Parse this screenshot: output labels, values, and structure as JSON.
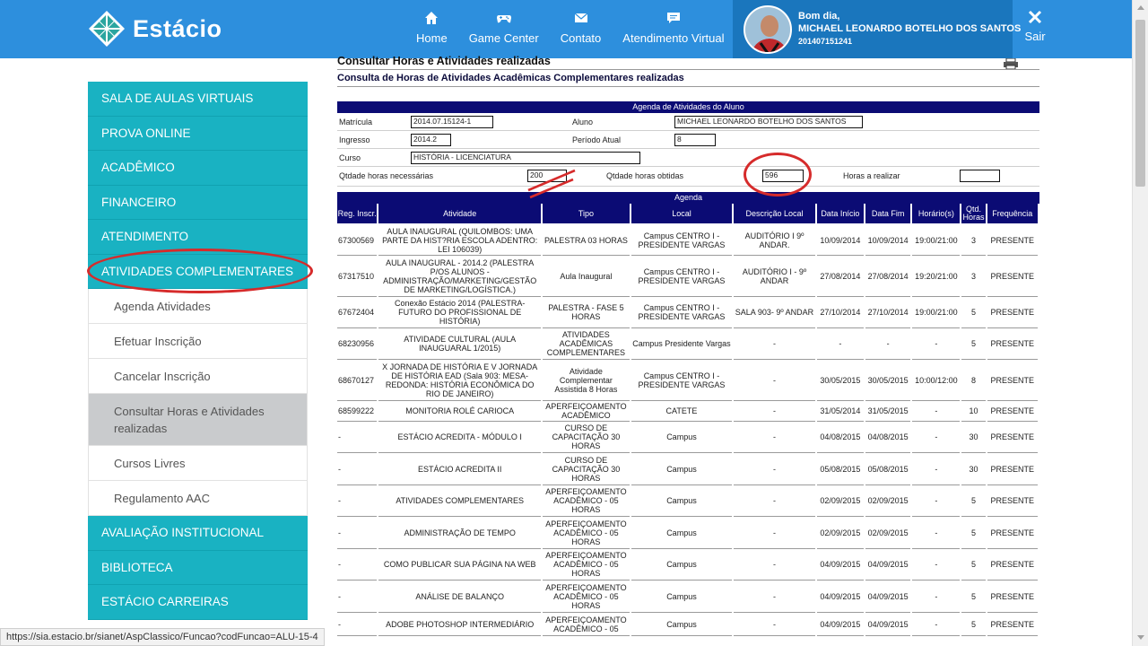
{
  "brand": {
    "name": "Estácio"
  },
  "nav": [
    {
      "label": "Home",
      "icon": "home-icon"
    },
    {
      "label": "Game Center",
      "icon": "gamepad-icon"
    },
    {
      "label": "Contato",
      "icon": "mail-icon"
    },
    {
      "label": "Atendimento Virtual",
      "icon": "chat-icon"
    }
  ],
  "user": {
    "greeting": "Bom dia,",
    "name": "MICHAEL LEONARDO BOTELHO DOS SANTOS",
    "matricula": "201407151241"
  },
  "logout_label": "Sair",
  "sidebar": {
    "top": [
      "SALA DE AULAS VIRTUAIS",
      "PROVA ONLINE",
      "ACADÊMICO",
      "FINANCEIRO",
      "ATENDIMENTO",
      "ATIVIDADES COMPLEMENTARES"
    ],
    "sub": [
      "Agenda Atividades",
      "Efetuar Inscrição",
      "Cancelar Inscrição",
      "Consultar Horas e Atividades realizadas",
      "Cursos Livres",
      "Regulamento AAC"
    ],
    "bottom": [
      "AVALIAÇÃO INSTITUCIONAL",
      "BIBLIOTECA",
      "ESTÁCIO CARREIRAS"
    ]
  },
  "page": {
    "title": "Consultar Horas e Atividades realizadas",
    "subtitle": "Consulta de Horas de Atividades Acadêmicas Complementares realizadas",
    "agenda_header": "Agenda de Atividades do Aluno",
    "labels": {
      "matricula": "Matrícula",
      "aluno": "Aluno",
      "ingresso": "Ingresso",
      "periodo": "Período Atual",
      "curso": "Curso",
      "horas_nec": "Qtdade horas necessárias",
      "horas_obt": "Qtdade horas obtidas",
      "horas_real": "Horas a realizar"
    },
    "values": {
      "matricula": "2014.07.15124-1",
      "aluno": "MICHAEL LEONARDO BOTELHO DOS SANTOS",
      "ingresso": "2014.2",
      "periodo": "8",
      "curso": "HISTÓRIA - LICENCIATURA",
      "horas_nec": "200",
      "horas_obt": "596",
      "horas_real": ""
    },
    "agenda_title": "Agenda"
  },
  "table": {
    "headers": [
      "Reg. Inscr.",
      "Atividade",
      "Tipo",
      "Local",
      "Descrição Local",
      "Data Início",
      "Data Fim",
      "Horário(s)",
      "Qtd. Horas",
      "Frequência"
    ],
    "rows": [
      [
        "67300569",
        "AULA INAUGURAL (QUILOMBOS: UMA PARTE DA HIST?RIA ESCOLA ADENTRO: LEI 106039)",
        "PALESTRA 03 HORAS",
        "Campus CENTRO I - PRESIDENTE VARGAS",
        "AUDITÓRIO I 9º ANDAR.",
        "10/09/2014",
        "10/09/2014",
        "19:00/21:00",
        "3",
        "PRESENTE"
      ],
      [
        "67317510",
        "AULA INAUGURAL - 2014.2 (PALESTRA P/OS ALUNOS - ADMINISTRAÇÃO/MARKETING/GESTÃO DE MARKETING/LOGÍSTICA.)",
        "Aula Inaugural",
        "Campus CENTRO I - PRESIDENTE VARGAS",
        "AUDITÓRIO I - 9º ANDAR",
        "27/08/2014",
        "27/08/2014",
        "19:20/21:00",
        "3",
        "PRESENTE"
      ],
      [
        "67672404",
        "Conexão Estácio 2014 (PALESTRA- FUTURO DO PROFISSIONAL DE HISTÓRIA)",
        "PALESTRA - FASE 5 HORAS",
        "Campus CENTRO I - PRESIDENTE VARGAS",
        "SALA 903- 9º ANDAR",
        "27/10/2014",
        "27/10/2014",
        "19:00/21:00",
        "5",
        "PRESENTE"
      ],
      [
        "68230956",
        "ATIVIDADE CULTURAL (AULA INAUGUARAL 1/2015)",
        "ATIVIDADES ACADÊMICAS COMPLEMENTARES",
        "Campus Presidente Vargas",
        "-",
        "-",
        "-",
        "-",
        "5",
        "PRESENTE"
      ],
      [
        "68670127",
        "X JORNADA DE HISTÓRIA E V JORNADA DE HISTÓRIA EAD (Sala 903: MESA-REDONDA: HISTÓRIA ECONÔMICA DO RIO DE JANEIRO)",
        "Atividade Complementar Assistida 8 Horas",
        "Campus CENTRO I - PRESIDENTE VARGAS",
        "-",
        "30/05/2015",
        "30/05/2015",
        "10:00/12:00",
        "8",
        "PRESENTE"
      ],
      [
        "68599222",
        "MONITORIA ROLÉ CARIOCA",
        "APERFEIÇOAMENTO ACADÊMICO",
        "CATETE",
        "-",
        "31/05/2014",
        "31/05/2015",
        "-",
        "10",
        "PRESENTE"
      ],
      [
        "-",
        "ESTÁCIO ACREDITA - MÓDULO I",
        "CURSO DE CAPACITAÇÃO 30 HORAS",
        "Campus",
        "-",
        "04/08/2015",
        "04/08/2015",
        "-",
        "30",
        "PRESENTE"
      ],
      [
        "-",
        "ESTÁCIO ACREDITA II",
        "CURSO DE CAPACITAÇÃO 30 HORAS",
        "Campus",
        "-",
        "05/08/2015",
        "05/08/2015",
        "-",
        "30",
        "PRESENTE"
      ],
      [
        "-",
        "ATIVIDADES COMPLEMENTARES",
        "APERFEIÇOAMENTO ACADÊMICO - 05 HORAS",
        "Campus",
        "-",
        "02/09/2015",
        "02/09/2015",
        "-",
        "5",
        "PRESENTE"
      ],
      [
        "-",
        "ADMINISTRAÇÃO DE TEMPO",
        "APERFEIÇOAMENTO ACADÊMICO - 05 HORAS",
        "Campus",
        "-",
        "02/09/2015",
        "02/09/2015",
        "-",
        "5",
        "PRESENTE"
      ],
      [
        "-",
        "COMO PUBLICAR SUA PÁGINA NA WEB",
        "APERFEIÇOAMENTO ACADÊMICO - 05 HORAS",
        "Campus",
        "-",
        "04/09/2015",
        "04/09/2015",
        "-",
        "5",
        "PRESENTE"
      ],
      [
        "-",
        "ANÁLISE DE BALANÇO",
        "APERFEIÇOAMENTO ACADÊMICO - 05 HORAS",
        "Campus",
        "-",
        "04/09/2015",
        "04/09/2015",
        "-",
        "5",
        "PRESENTE"
      ],
      [
        "-",
        "ADOBE PHOTOSHOP INTERMEDIÁRIO",
        "APERFEIÇOAMENTO ACADÊMICO - 05",
        "Campus",
        "-",
        "04/09/2015",
        "04/09/2015",
        "-",
        "5",
        "PRESENTE"
      ]
    ]
  },
  "status_url": "https://sia.estacio.br/sianet/AspClassico/Funcao?codFuncao=ALU-15-4",
  "colors": {
    "topbar": "#2d8fdd",
    "sidebar": "#19b2c2",
    "table_header": "#0b0b74",
    "annotation": "#d62b2b"
  }
}
